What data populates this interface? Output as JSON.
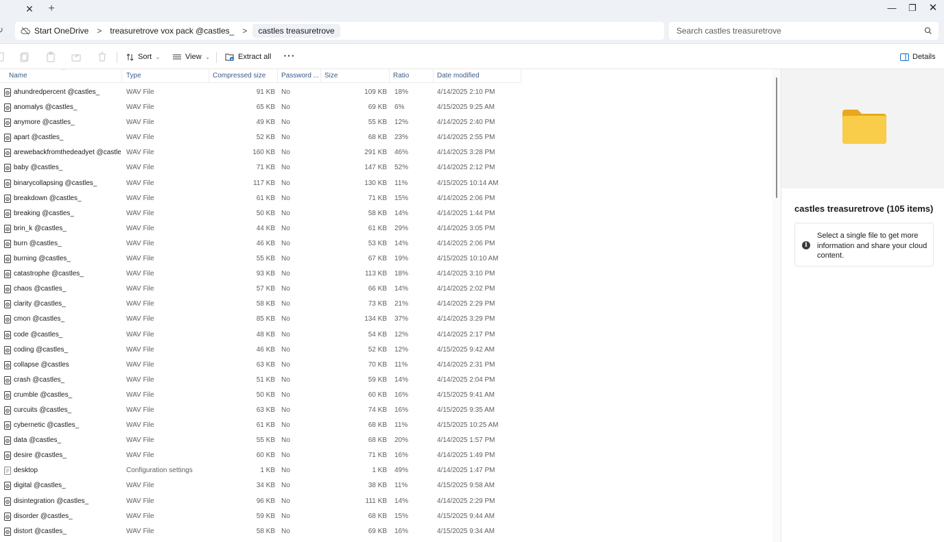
{
  "window": {
    "tab_close_glyph": "✕",
    "tab_add_glyph": "+",
    "minimize_glyph": "—",
    "maximize_glyph": "❐",
    "close_glyph": "✕"
  },
  "address": {
    "breadcrumb": [
      "Start OneDrive",
      "treasuretrove vox pack @castles_",
      "castles treasuretrove"
    ],
    "separator": ">",
    "search_placeholder": "Search castles treasuretrove"
  },
  "toolbar": {
    "sort_label": "Sort",
    "view_label": "View",
    "extract_all_label": "Extract all",
    "more_label": "···",
    "details_label": "Details"
  },
  "columns": {
    "name": "Name",
    "type": "Type",
    "compressed_size": "Compressed size",
    "password": "Password ...",
    "size": "Size",
    "ratio": "Ratio",
    "date_modified": "Date modified"
  },
  "files": [
    {
      "name": "ahundredpercent @castles_",
      "type": "WAV File",
      "compressed": "91 KB",
      "password": "No",
      "size": "109 KB",
      "ratio": "18%",
      "date": "4/14/2025 2:10 PM",
      "icon": "audio-file-icon"
    },
    {
      "name": "anomalys @castles_",
      "type": "WAV File",
      "compressed": "65 KB",
      "password": "No",
      "size": "69 KB",
      "ratio": "6%",
      "date": "4/15/2025 9:25 AM",
      "icon": "audio-file-icon"
    },
    {
      "name": "anymore @castles_",
      "type": "WAV File",
      "compressed": "49 KB",
      "password": "No",
      "size": "55 KB",
      "ratio": "12%",
      "date": "4/14/2025 2:40 PM",
      "icon": "audio-file-icon"
    },
    {
      "name": "apart @castles_",
      "type": "WAV File",
      "compressed": "52 KB",
      "password": "No",
      "size": "68 KB",
      "ratio": "23%",
      "date": "4/14/2025 2:55 PM",
      "icon": "audio-file-icon"
    },
    {
      "name": "arewebackfromthedeadyet @castle...",
      "type": "WAV File",
      "compressed": "160 KB",
      "password": "No",
      "size": "291 KB",
      "ratio": "46%",
      "date": "4/14/2025 3:28 PM",
      "icon": "audio-file-icon"
    },
    {
      "name": "baby @castles_",
      "type": "WAV File",
      "compressed": "71 KB",
      "password": "No",
      "size": "147 KB",
      "ratio": "52%",
      "date": "4/14/2025 2:12 PM",
      "icon": "audio-file-icon"
    },
    {
      "name": "binarycollapsing @castles_",
      "type": "WAV File",
      "compressed": "117 KB",
      "password": "No",
      "size": "130 KB",
      "ratio": "11%",
      "date": "4/15/2025 10:14 AM",
      "icon": "audio-file-icon"
    },
    {
      "name": "breakdown @castles_",
      "type": "WAV File",
      "compressed": "61 KB",
      "password": "No",
      "size": "71 KB",
      "ratio": "15%",
      "date": "4/14/2025 2:06 PM",
      "icon": "audio-file-icon"
    },
    {
      "name": "breaking @castles_",
      "type": "WAV File",
      "compressed": "50 KB",
      "password": "No",
      "size": "58 KB",
      "ratio": "14%",
      "date": "4/14/2025 1:44 PM",
      "icon": "audio-file-icon"
    },
    {
      "name": "brin_k @castles_",
      "type": "WAV File",
      "compressed": "44 KB",
      "password": "No",
      "size": "61 KB",
      "ratio": "29%",
      "date": "4/14/2025 3:05 PM",
      "icon": "audio-file-icon"
    },
    {
      "name": "burn @castles_",
      "type": "WAV File",
      "compressed": "46 KB",
      "password": "No",
      "size": "53 KB",
      "ratio": "14%",
      "date": "4/14/2025 2:06 PM",
      "icon": "audio-file-icon"
    },
    {
      "name": "burning @castles_",
      "type": "WAV File",
      "compressed": "55 KB",
      "password": "No",
      "size": "67 KB",
      "ratio": "19%",
      "date": "4/15/2025 10:10 AM",
      "icon": "audio-file-icon"
    },
    {
      "name": "catastrophe @castles_",
      "type": "WAV File",
      "compressed": "93 KB",
      "password": "No",
      "size": "113 KB",
      "ratio": "18%",
      "date": "4/14/2025 3:10 PM",
      "icon": "audio-file-icon"
    },
    {
      "name": "chaos @castles_",
      "type": "WAV File",
      "compressed": "57 KB",
      "password": "No",
      "size": "66 KB",
      "ratio": "14%",
      "date": "4/14/2025 2:02 PM",
      "icon": "audio-file-icon"
    },
    {
      "name": "clarity @castles_",
      "type": "WAV File",
      "compressed": "58 KB",
      "password": "No",
      "size": "73 KB",
      "ratio": "21%",
      "date": "4/14/2025 2:29 PM",
      "icon": "audio-file-icon"
    },
    {
      "name": "cmon @castles_",
      "type": "WAV File",
      "compressed": "85 KB",
      "password": "No",
      "size": "134 KB",
      "ratio": "37%",
      "date": "4/14/2025 3:29 PM",
      "icon": "audio-file-icon"
    },
    {
      "name": "code @castles_",
      "type": "WAV File",
      "compressed": "48 KB",
      "password": "No",
      "size": "54 KB",
      "ratio": "12%",
      "date": "4/14/2025 2:17 PM",
      "icon": "audio-file-icon"
    },
    {
      "name": "coding @castles_",
      "type": "WAV File",
      "compressed": "46 KB",
      "password": "No",
      "size": "52 KB",
      "ratio": "12%",
      "date": "4/15/2025 9:42 AM",
      "icon": "audio-file-icon"
    },
    {
      "name": "collapse @castles",
      "type": "WAV File",
      "compressed": "63 KB",
      "password": "No",
      "size": "70 KB",
      "ratio": "11%",
      "date": "4/14/2025 2:31 PM",
      "icon": "audio-file-icon"
    },
    {
      "name": "crash @castles_",
      "type": "WAV File",
      "compressed": "51 KB",
      "password": "No",
      "size": "59 KB",
      "ratio": "14%",
      "date": "4/14/2025 2:04 PM",
      "icon": "audio-file-icon"
    },
    {
      "name": "crumble @castles_",
      "type": "WAV File",
      "compressed": "50 KB",
      "password": "No",
      "size": "60 KB",
      "ratio": "16%",
      "date": "4/15/2025 9:41 AM",
      "icon": "audio-file-icon"
    },
    {
      "name": "curcuits @castles_",
      "type": "WAV File",
      "compressed": "63 KB",
      "password": "No",
      "size": "74 KB",
      "ratio": "16%",
      "date": "4/15/2025 9:35 AM",
      "icon": "audio-file-icon"
    },
    {
      "name": "cybernetic @castles_",
      "type": "WAV File",
      "compressed": "61 KB",
      "password": "No",
      "size": "68 KB",
      "ratio": "11%",
      "date": "4/15/2025 10:25 AM",
      "icon": "audio-file-icon"
    },
    {
      "name": "data @castles_",
      "type": "WAV File",
      "compressed": "55 KB",
      "password": "No",
      "size": "68 KB",
      "ratio": "20%",
      "date": "4/14/2025 1:57 PM",
      "icon": "audio-file-icon"
    },
    {
      "name": "desire @castles_",
      "type": "WAV File",
      "compressed": "60 KB",
      "password": "No",
      "size": "71 KB",
      "ratio": "16%",
      "date": "4/14/2025 1:49 PM",
      "icon": "audio-file-icon"
    },
    {
      "name": "desktop",
      "type": "Configuration settings",
      "compressed": "1 KB",
      "password": "No",
      "size": "1 KB",
      "ratio": "49%",
      "date": "4/14/2025 1:47 PM",
      "icon": "settings-file-icon"
    },
    {
      "name": "digital @castles_",
      "type": "WAV File",
      "compressed": "34 KB",
      "password": "No",
      "size": "38 KB",
      "ratio": "11%",
      "date": "4/15/2025 9:58 AM",
      "icon": "audio-file-icon"
    },
    {
      "name": "disintegration @castles_",
      "type": "WAV File",
      "compressed": "96 KB",
      "password": "No",
      "size": "111 KB",
      "ratio": "14%",
      "date": "4/14/2025 2:29 PM",
      "icon": "audio-file-icon"
    },
    {
      "name": "disorder @castles_",
      "type": "WAV File",
      "compressed": "59 KB",
      "password": "No",
      "size": "68 KB",
      "ratio": "15%",
      "date": "4/15/2025 9:44 AM",
      "icon": "audio-file-icon"
    },
    {
      "name": "distort @castles_",
      "type": "WAV File",
      "compressed": "58 KB",
      "password": "No",
      "size": "69 KB",
      "ratio": "16%",
      "date": "4/15/2025 9:34 AM",
      "icon": "audio-file-icon"
    }
  ],
  "details_pane": {
    "title": "castles treasuretrove (105 items)",
    "info_text": "Select a single file to get more information and share your cloud content.",
    "info_glyph": "i"
  },
  "colors": {
    "chrome_bg": "#eef1f6",
    "folder_yellow": "#f8c93b",
    "accent_blue": "#0f6cbd"
  }
}
